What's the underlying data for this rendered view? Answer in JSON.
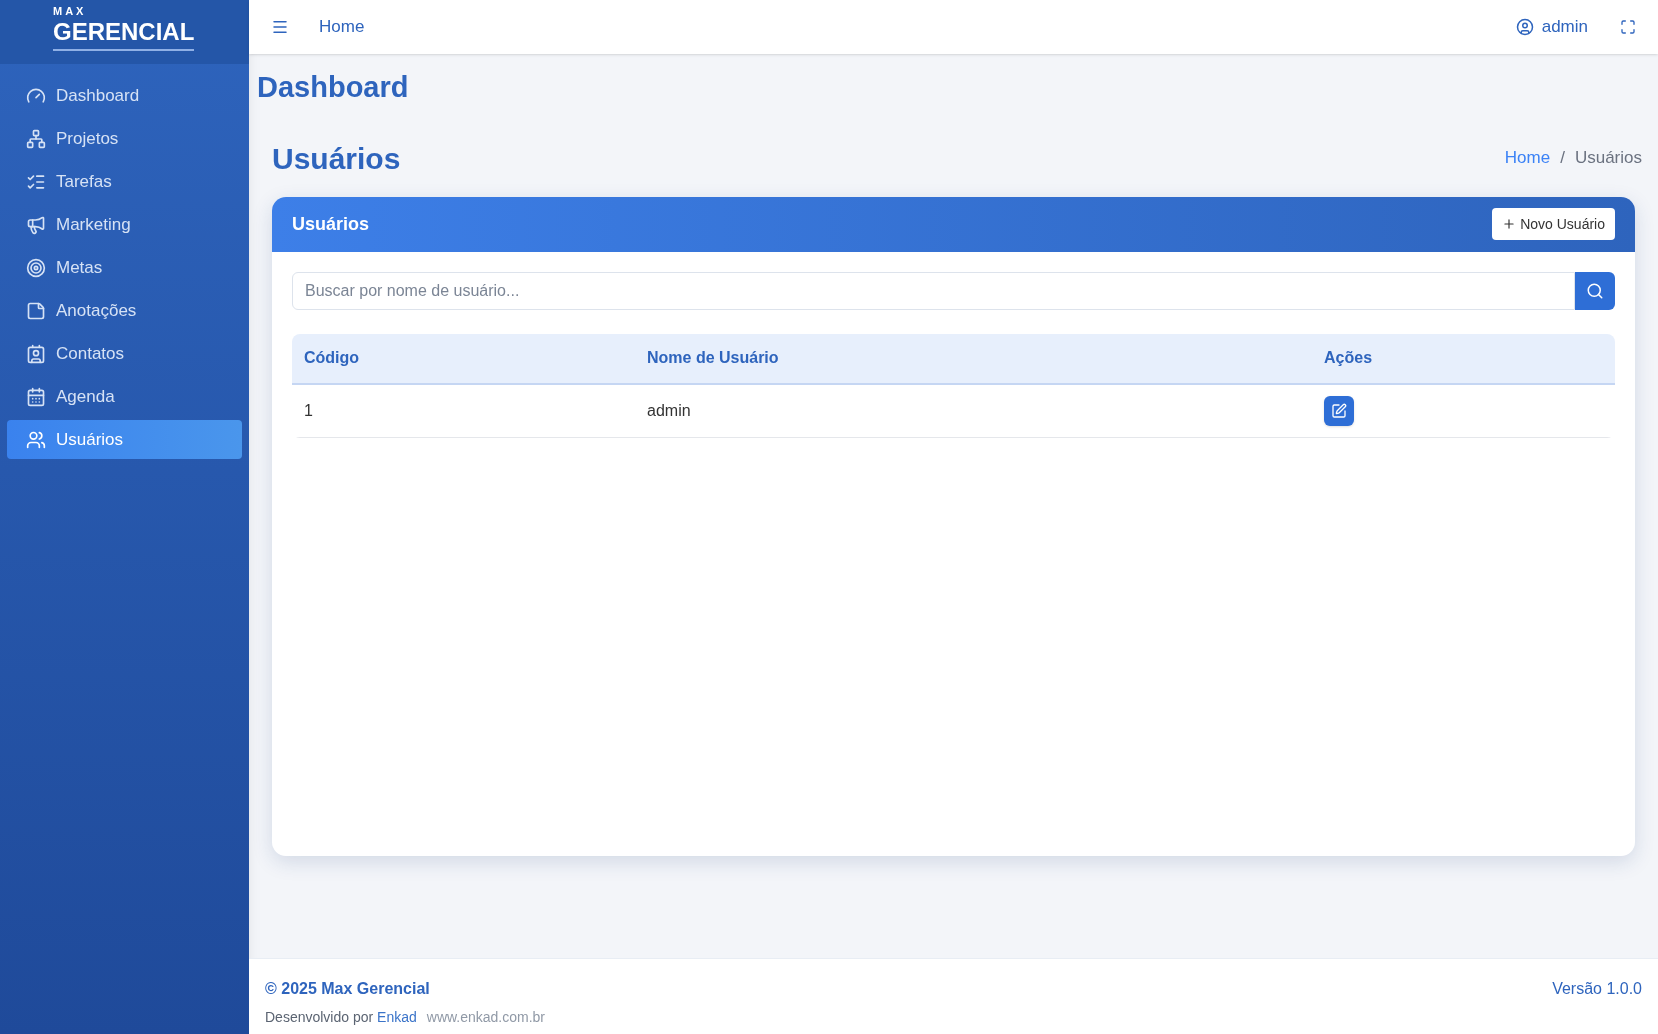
{
  "logo": {
    "small": "MAX",
    "large": "GERENCIAL"
  },
  "sidebar": {
    "items": [
      {
        "label": "Dashboard",
        "selected": false
      },
      {
        "label": "Projetos",
        "selected": false
      },
      {
        "label": "Tarefas",
        "selected": false
      },
      {
        "label": "Marketing",
        "selected": false
      },
      {
        "label": "Metas",
        "selected": false
      },
      {
        "label": "Anotações",
        "selected": false
      },
      {
        "label": "Contatos",
        "selected": false
      },
      {
        "label": "Agenda",
        "selected": false
      },
      {
        "label": "Usuários",
        "selected": true
      }
    ]
  },
  "topbar": {
    "home_link": "Home",
    "user": "admin"
  },
  "page_title": "Dashboard",
  "section": {
    "title": "Usuários",
    "breadcrumb": [
      "Home",
      "Usuários"
    ],
    "breadcrumb_separator": "/"
  },
  "card": {
    "title": "Usuários",
    "new_button": "Novo Usuário",
    "search": {
      "placeholder": "Buscar por nome de usuário..."
    },
    "table": {
      "columns": [
        "Código",
        "Nome de Usuário",
        "Ações"
      ],
      "rows": [
        {
          "code": "1",
          "username": "admin"
        }
      ]
    }
  },
  "footer": {
    "copyright": "© 2025 Max Gerencial",
    "developed_by": "Desenvolvido por",
    "developer": "Enkad",
    "website": "www.enkad.com.br",
    "version": "Versão 1.0.0"
  }
}
